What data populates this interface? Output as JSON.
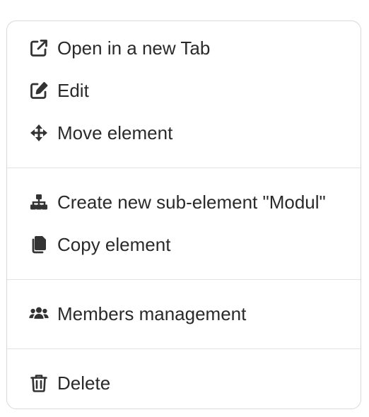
{
  "menu": {
    "items": [
      {
        "label": "Open in a new Tab",
        "icon": "external-link-icon"
      },
      {
        "label": "Edit",
        "icon": "edit-icon"
      },
      {
        "label": "Move element",
        "icon": "move-arrows-icon"
      },
      {
        "label": "Create new sub-element \"Modul\"",
        "icon": "sitemap-icon"
      },
      {
        "label": "Copy element",
        "icon": "copy-icon"
      },
      {
        "label": "Members management",
        "icon": "users-icon"
      },
      {
        "label": "Delete",
        "icon": "trash-icon"
      }
    ]
  },
  "colors": {
    "text": "#2a2a2a",
    "icon": "#333333",
    "border": "#d9d9d9",
    "divider": "#e3e3e3"
  }
}
